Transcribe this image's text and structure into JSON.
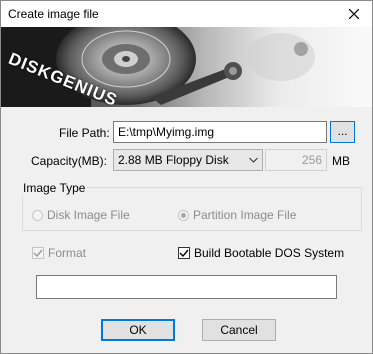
{
  "window": {
    "title": "Create image file",
    "close_icon": "close-icon"
  },
  "banner": {
    "brand": "DISKGENIUS"
  },
  "file_path": {
    "label": "File Path:",
    "value": "E:\\tmp\\Myimg.img",
    "browse_label": "..."
  },
  "capacity": {
    "label": "Capacity(MB):",
    "selected": "2.88 MB Floppy Disk",
    "size_value": "256",
    "unit": "MB"
  },
  "image_type": {
    "title": "Image Type",
    "options": [
      {
        "label": "Disk Image File",
        "checked": false,
        "enabled": false
      },
      {
        "label": "Partition Image File",
        "checked": true,
        "enabled": false
      }
    ]
  },
  "options": {
    "format_label": "Format",
    "format_checked": true,
    "format_enabled": false,
    "bootable_label": "Build Bootable DOS System",
    "bootable_checked": true
  },
  "progress": {
    "value": 0
  },
  "buttons": {
    "ok": "OK",
    "cancel": "Cancel"
  },
  "colors": {
    "accent": "#0078d7",
    "dialog_bg": "#f0f0f0"
  }
}
